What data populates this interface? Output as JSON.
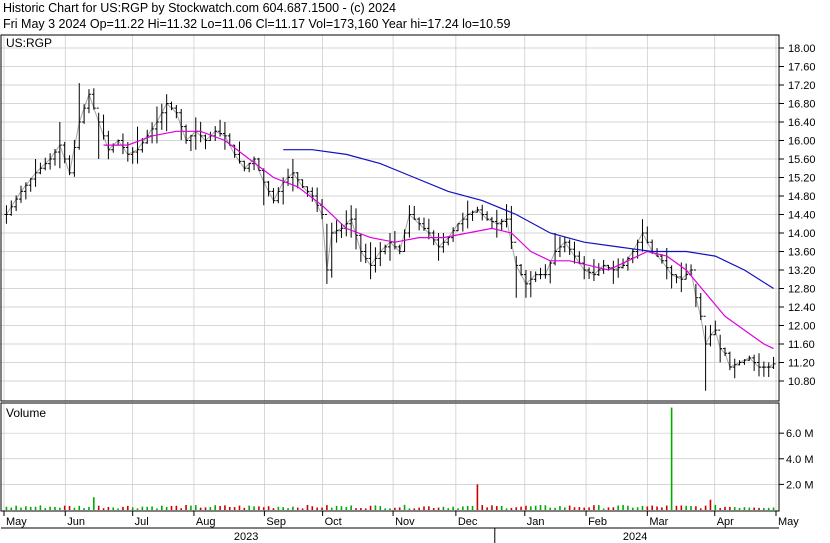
{
  "header": {
    "line1": "Historic Chart for US:RGP by Stockwatch.com 604.687.1500 - (c) 2024",
    "line2": "Fri May  3 2024  Op=11.22  Hi=11.32  Lo=11.06  Cl=11.17  Vol=173,160  Year hi=17.24  lo=10.59"
  },
  "colors": {
    "price": "#000000",
    "ma_short": "#e000e0",
    "ma_long": "#1010c0",
    "volume_up": "#00aa00",
    "volume_down": "#cc0000",
    "grid": "#c8c8c8"
  },
  "chart_data": [
    {
      "type": "ohlc",
      "title": "US:RGP",
      "ylim": [
        10.5,
        18.0
      ],
      "yticks": [
        "18.00",
        "17.60",
        "17.20",
        "16.80",
        "16.40",
        "16.00",
        "15.60",
        "15.20",
        "14.80",
        "14.40",
        "14.00",
        "13.60",
        "13.20",
        "12.80",
        "12.40",
        "12.00",
        "11.60",
        "11.20",
        "10.80"
      ],
      "grid": true,
      "x_months": [
        "May",
        "Jun",
        "Jul",
        "Aug",
        "Sep",
        "Oct",
        "Nov",
        "Dec",
        "Jan",
        "Feb",
        "Mar",
        "Apr",
        "May"
      ],
      "x_years": [
        "2023",
        "2024"
      ],
      "close_path": [
        [
          0,
          14.4
        ],
        [
          3,
          14.9
        ],
        [
          6,
          15.3
        ],
        [
          9,
          15.6
        ],
        [
          11,
          15.9
        ],
        [
          13,
          15.3
        ],
        [
          15,
          16.4
        ],
        [
          17,
          17.0
        ],
        [
          19,
          16.4
        ],
        [
          21,
          15.8
        ],
        [
          23,
          16.0
        ],
        [
          25,
          15.7
        ],
        [
          27,
          15.8
        ],
        [
          29,
          16.1
        ],
        [
          31,
          16.4
        ],
        [
          33,
          16.8
        ],
        [
          35,
          16.6
        ],
        [
          37,
          16.0
        ],
        [
          39,
          16.2
        ],
        [
          41,
          16.0
        ],
        [
          43,
          16.2
        ],
        [
          45,
          16.1
        ],
        [
          47,
          15.7
        ],
        [
          49,
          15.4
        ],
        [
          51,
          15.6
        ],
        [
          53,
          15.1
        ],
        [
          55,
          14.7
        ],
        [
          57,
          15.1
        ],
        [
          59,
          15.3
        ],
        [
          61,
          15.0
        ],
        [
          63,
          14.8
        ],
        [
          65,
          14.4
        ],
        [
          66,
          13.2
        ],
        [
          67,
          14.0
        ],
        [
          69,
          14.1
        ],
        [
          71,
          14.3
        ],
        [
          73,
          13.6
        ],
        [
          75,
          13.3
        ],
        [
          77,
          13.6
        ],
        [
          79,
          13.8
        ],
        [
          81,
          13.6
        ],
        [
          83,
          14.4
        ],
        [
          85,
          14.2
        ],
        [
          87,
          14.0
        ],
        [
          89,
          13.7
        ],
        [
          91,
          13.9
        ],
        [
          93,
          14.2
        ],
        [
          95,
          14.4
        ],
        [
          97,
          14.5
        ],
        [
          99,
          14.3
        ],
        [
          101,
          14.2
        ],
        [
          103,
          14.3
        ],
        [
          105,
          13.3
        ],
        [
          107,
          12.9
        ],
        [
          109,
          13.1
        ],
        [
          111,
          13.1
        ],
        [
          113,
          13.6
        ],
        [
          115,
          13.8
        ],
        [
          117,
          13.5
        ],
        [
          119,
          13.2
        ],
        [
          121,
          13.1
        ],
        [
          123,
          13.3
        ],
        [
          125,
          13.2
        ],
        [
          127,
          13.3
        ],
        [
          129,
          13.6
        ],
        [
          131,
          14.0
        ],
        [
          133,
          13.6
        ],
        [
          135,
          13.4
        ],
        [
          137,
          13.1
        ],
        [
          139,
          13.0
        ],
        [
          141,
          13.2
        ],
        [
          142,
          12.6
        ],
        [
          143,
          12.2
        ],
        [
          144,
          11.6
        ],
        [
          145,
          11.8
        ],
        [
          146,
          11.9
        ],
        [
          147,
          11.5
        ],
        [
          148,
          11.4
        ],
        [
          149,
          11.1
        ],
        [
          151,
          11.2
        ],
        [
          153,
          11.3
        ],
        [
          155,
          11.1
        ],
        [
          157,
          11.1
        ],
        [
          158,
          11.17
        ]
      ],
      "ohlc_ranges": [
        [
          0,
          14.2,
          14.6
        ],
        [
          6,
          15.0,
          15.6
        ],
        [
          11,
          15.4,
          16.4
        ],
        [
          15,
          15.8,
          17.24
        ],
        [
          19,
          15.6,
          16.6
        ],
        [
          27,
          15.5,
          16.3
        ],
        [
          33,
          16.2,
          17.0
        ],
        [
          39,
          15.8,
          16.5
        ],
        [
          45,
          15.8,
          16.4
        ],
        [
          53,
          14.6,
          15.4
        ],
        [
          59,
          14.9,
          15.6
        ],
        [
          66,
          12.9,
          14.2
        ],
        [
          71,
          13.9,
          14.6
        ],
        [
          75,
          13.0,
          13.8
        ],
        [
          79,
          13.4,
          14.0
        ],
        [
          83,
          13.9,
          14.6
        ],
        [
          89,
          13.4,
          14.0
        ],
        [
          95,
          14.1,
          14.7
        ],
        [
          101,
          13.9,
          14.5
        ],
        [
          105,
          12.6,
          13.5
        ],
        [
          107,
          12.6,
          13.2
        ],
        [
          113,
          13.3,
          14.0
        ],
        [
          119,
          13.0,
          13.5
        ],
        [
          125,
          12.9,
          13.4
        ],
        [
          131,
          13.6,
          14.3
        ],
        [
          137,
          12.8,
          13.3
        ],
        [
          142,
          12.4,
          12.9
        ],
        [
          144,
          10.59,
          12.0
        ],
        [
          147,
          11.2,
          11.8
        ],
        [
          155,
          10.9,
          11.4
        ],
        [
          158,
          11.06,
          11.32
        ]
      ],
      "ma_short": [
        [
          20,
          15.9
        ],
        [
          25,
          15.9
        ],
        [
          30,
          16.1
        ],
        [
          35,
          16.2
        ],
        [
          40,
          16.2
        ],
        [
          45,
          16.0
        ],
        [
          50,
          15.6
        ],
        [
          55,
          15.2
        ],
        [
          60,
          15.0
        ],
        [
          65,
          14.6
        ],
        [
          70,
          14.1
        ],
        [
          75,
          13.9
        ],
        [
          80,
          13.8
        ],
        [
          85,
          13.9
        ],
        [
          90,
          13.9
        ],
        [
          95,
          14.0
        ],
        [
          100,
          14.1
        ],
        [
          104,
          14.0
        ],
        [
          108,
          13.6
        ],
        [
          112,
          13.4
        ],
        [
          116,
          13.4
        ],
        [
          120,
          13.3
        ],
        [
          124,
          13.2
        ],
        [
          128,
          13.4
        ],
        [
          132,
          13.6
        ],
        [
          136,
          13.5
        ],
        [
          140,
          13.2
        ],
        [
          144,
          12.7
        ],
        [
          148,
          12.2
        ],
        [
          152,
          11.9
        ],
        [
          156,
          11.6
        ],
        [
          158,
          11.5
        ]
      ],
      "ma_long": [
        [
          57,
          15.8
        ],
        [
          63,
          15.8
        ],
        [
          70,
          15.7
        ],
        [
          77,
          15.5
        ],
        [
          84,
          15.2
        ],
        [
          91,
          14.9
        ],
        [
          98,
          14.7
        ],
        [
          105,
          14.4
        ],
        [
          112,
          14.0
        ],
        [
          119,
          13.8
        ],
        [
          126,
          13.7
        ],
        [
          133,
          13.6
        ],
        [
          140,
          13.6
        ],
        [
          146,
          13.5
        ],
        [
          152,
          13.2
        ],
        [
          158,
          12.8
        ]
      ]
    },
    {
      "type": "bar",
      "title": "Volume",
      "yticks": [
        "6.0 M",
        "4.0 M",
        "2.0 M"
      ],
      "ylim": [
        0,
        8.2
      ],
      "unit": "M",
      "spikes": [
        {
          "day": 18,
          "value": 1.0,
          "direction": "up"
        },
        {
          "day": 97,
          "value": 2.0,
          "direction": "down"
        },
        {
          "day": 137,
          "value": 8.0,
          "direction": "up"
        },
        {
          "day": 145,
          "value": 0.8,
          "direction": "down"
        }
      ]
    }
  ]
}
